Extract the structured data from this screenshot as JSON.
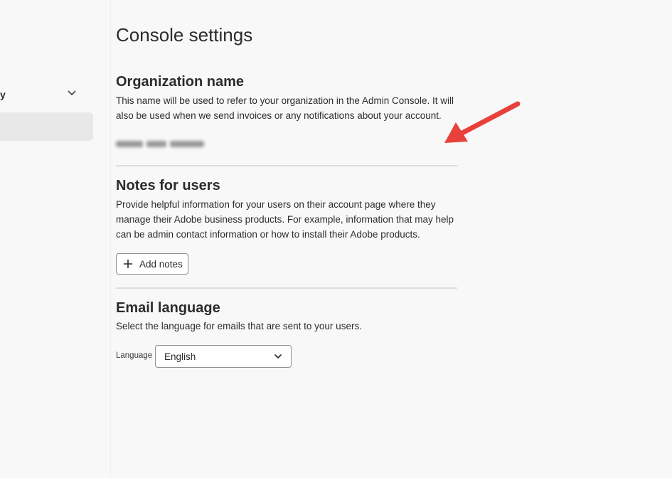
{
  "sidebar": {
    "group_label": "y",
    "group_chevron_icon": "chevron-down-icon"
  },
  "page": {
    "title": "Console settings"
  },
  "organization": {
    "title": "Organization name",
    "description": "This name will be used to refer to your organization in the Admin Console. It will also be used when we send invoices or any notifications about your account."
  },
  "notes": {
    "title": "Notes for users",
    "description": "Provide helpful information for your users on their account page where they manage their Adobe business products. For example, information that may help can be admin contact information or how to install their Adobe products.",
    "add_button_label": "Add notes",
    "add_button_icon": "plus-icon"
  },
  "email_language": {
    "title": "Email language",
    "description": "Select the language for emails that are sent to your users.",
    "field_label": "Language",
    "selected_value": "English",
    "select_icon": "chevron-down-icon"
  },
  "annotation": {
    "arrow_color": "#e8413c"
  }
}
